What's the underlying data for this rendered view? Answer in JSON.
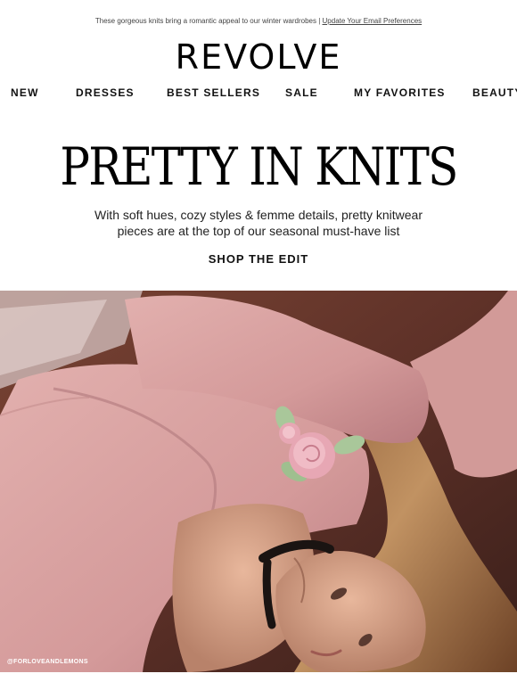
{
  "preheader": {
    "text": "These gorgeous knits bring a romantic appeal to our winter wardrobes | ",
    "link_label": "Update Your Email Preferences"
  },
  "brand": {
    "logo_text": "REVOLVE"
  },
  "nav": {
    "items": [
      {
        "label": "NEW"
      },
      {
        "label": "DRESSES"
      },
      {
        "label": "BEST SELLERS"
      },
      {
        "label": "SALE"
      },
      {
        "label": "MY FAVORITES"
      },
      {
        "label": "BEAUTY"
      }
    ]
  },
  "hero_text": {
    "headline": "PRETTY IN KNITS",
    "body_line_1": "With soft hues, cozy styles & femme details, pretty knitwear",
    "body_line_2": "pieces are at the top of our seasonal must-have list",
    "cta_label": "SHOP THE EDIT"
  },
  "hero_image": {
    "credit": "@FORLOVEANDLEMONS",
    "colors": {
      "background": "#6b3a2e",
      "sweater": "#d9a3a3",
      "rose": "#e7a7b4",
      "leaf": "#a9c79a",
      "hair": "#b88654",
      "skin": "#d9a48a",
      "choker": "#1a1412"
    }
  }
}
